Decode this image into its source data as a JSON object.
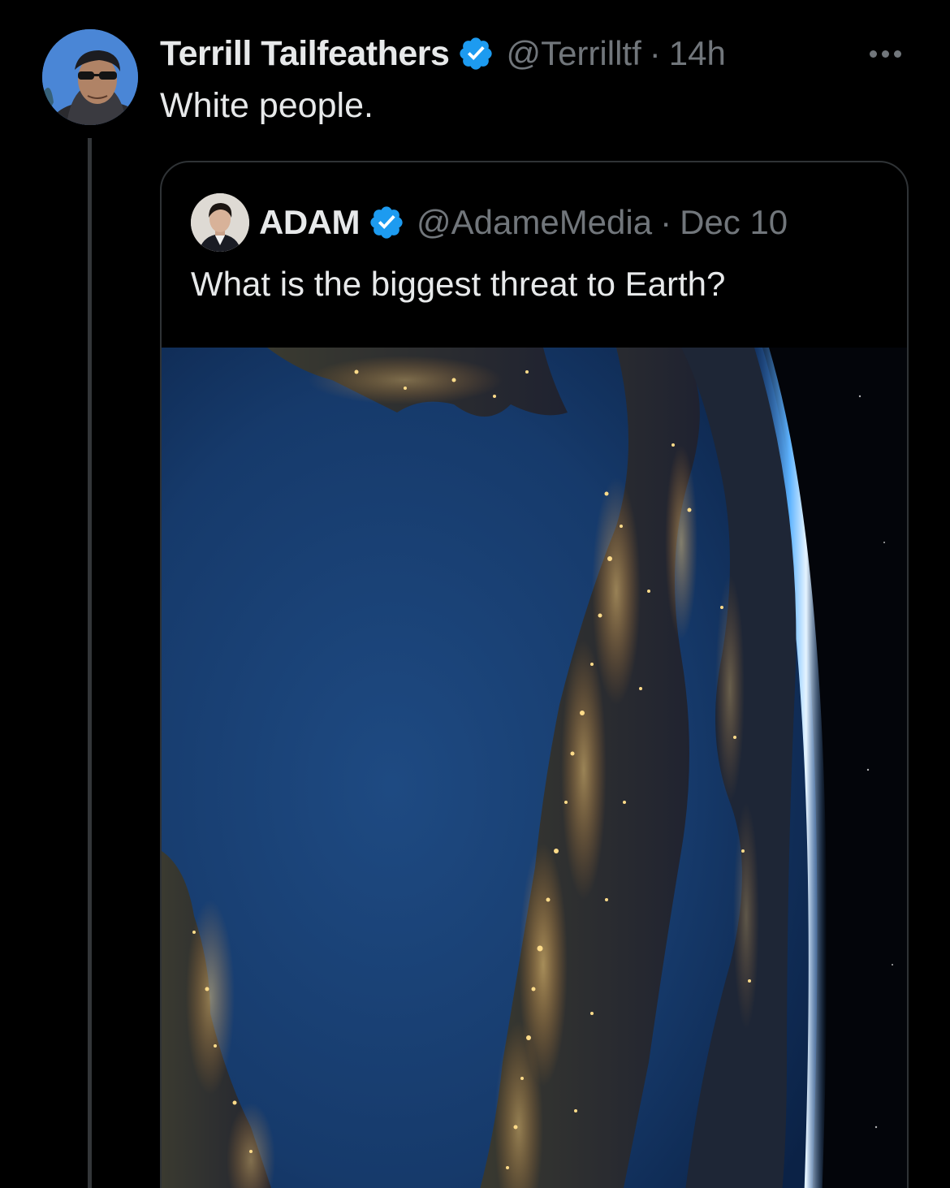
{
  "tweet": {
    "display_name": "Terrill Tailfeathers",
    "handle": "@Terrilltf",
    "separator": "·",
    "time": "14h",
    "text": "White people.",
    "verified": true,
    "avatar_icon": "profile-photo-sunglasses"
  },
  "quote": {
    "display_name": "ADAM",
    "handle": "@AdameMedia",
    "separator": "·",
    "date": "Dec 10",
    "text": "What is the biggest threat to Earth?",
    "verified": true,
    "avatar_icon": "profile-photo-man-suit",
    "media_icon": "earth-from-space-night-photo"
  },
  "colors": {
    "background": "#000000",
    "primary_text": "#e7e9ea",
    "secondary_text": "#71767b",
    "verified_blue": "#1d9bf0",
    "border": "#2f3336"
  },
  "more_icon": "more-horizontal-icon"
}
